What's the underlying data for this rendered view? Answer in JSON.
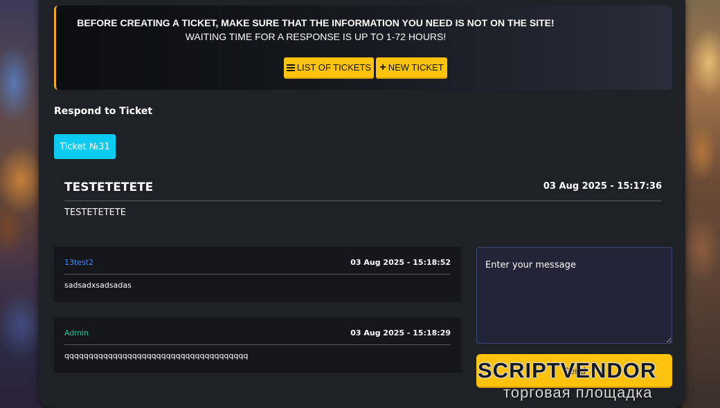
{
  "notice": {
    "line1": "BEFORE CREATING A TICKET, MAKE SURE THAT THE INFORMATION YOU NEED IS NOT ON THE SITE!",
    "line2": "WAITING TIME FOR A RESPONSE IS UP TO 1-72 HOURS!",
    "list_button": "LIST OF TICKETS",
    "new_button": "NEW TICKET"
  },
  "respond": {
    "title": "Respond to Ticket",
    "ticket_badge": "Ticket №31"
  },
  "ticket": {
    "subject": "TESTETETETE",
    "date": "03 Aug 2025 - 15:17:36",
    "body": "TESTETETETE"
  },
  "messages": [
    {
      "author": "13test2",
      "author_color": "#3d8bfd",
      "date": "03 Aug 2025 - 15:18:52",
      "text": "sadsadxsadsadas"
    },
    {
      "author": "Admin",
      "author_color": "#20c997",
      "date": "03 Aug 2025 - 15:18:29",
      "text": "qqqqqqqqqqqqqqqqqqqqqqqqqqqqqqqqqqqqqq"
    }
  ],
  "reply": {
    "placeholder": "Enter your message",
    "send_label": "Send"
  },
  "watermark": {
    "brand": "SCRIPTVENDOR",
    "tagline": "торговая площадка"
  },
  "colors": {
    "accent": "#ffc30b",
    "badge": "#0dcaf0"
  }
}
